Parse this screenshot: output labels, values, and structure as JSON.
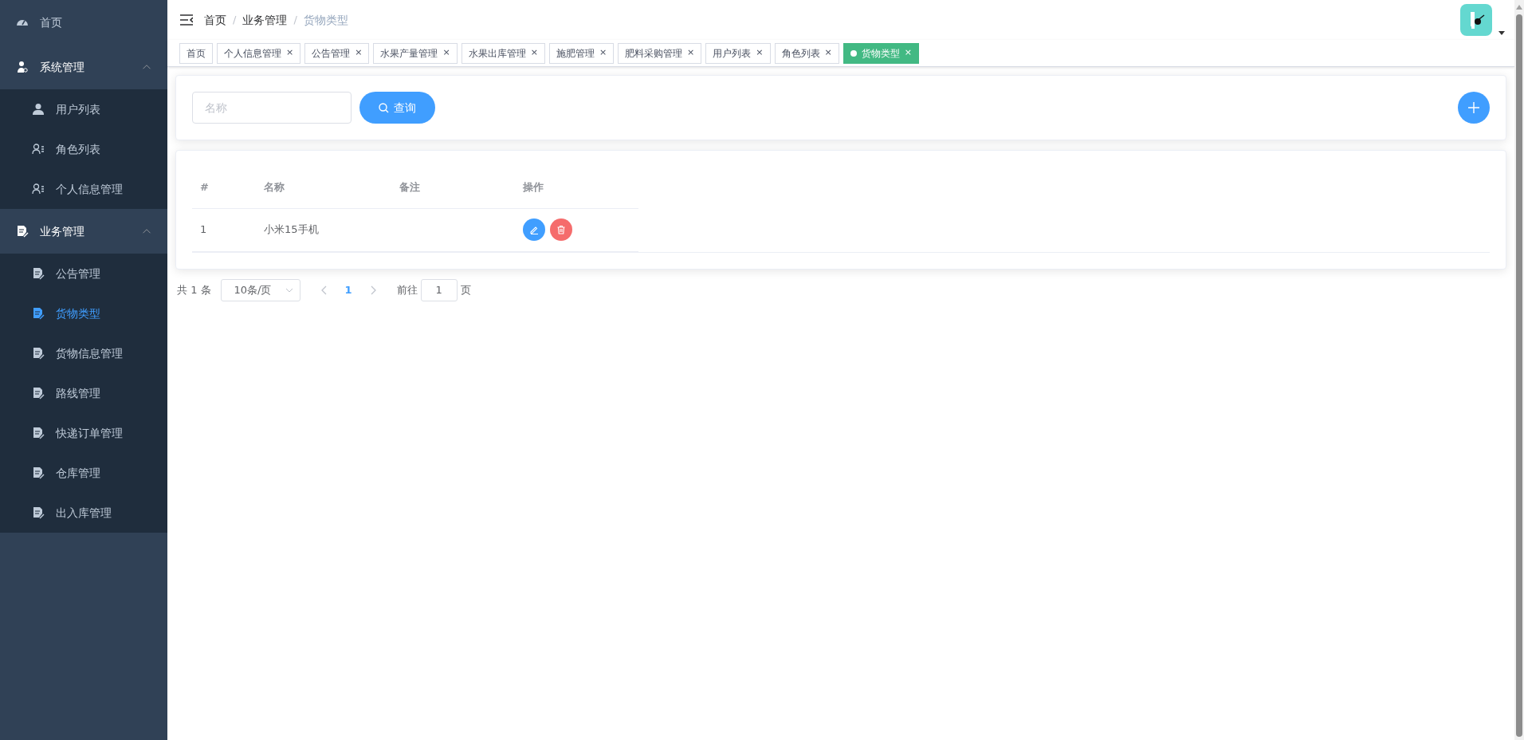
{
  "sidebar": {
    "items": [
      {
        "label": "首页",
        "selected": false
      },
      {
        "label": "系统管理",
        "selected": false,
        "expanded": true,
        "children": [
          {
            "label": "用户列表",
            "selected": false
          },
          {
            "label": "角色列表",
            "selected": false
          },
          {
            "label": "个人信息管理",
            "selected": false
          }
        ]
      },
      {
        "label": "业务管理",
        "selected": false,
        "expanded": true,
        "children": [
          {
            "label": "公告管理",
            "selected": false
          },
          {
            "label": "货物类型",
            "selected": true
          },
          {
            "label": "货物信息管理",
            "selected": false
          },
          {
            "label": "路线管理",
            "selected": false
          },
          {
            "label": "快递订单管理",
            "selected": false
          },
          {
            "label": "仓库管理",
            "selected": false
          },
          {
            "label": "出入库管理",
            "selected": false
          }
        ]
      }
    ]
  },
  "breadcrumb": [
    {
      "label": "首页",
      "separator": "/"
    },
    {
      "label": "业务管理",
      "separator": "/"
    },
    {
      "label": "货物类型"
    }
  ],
  "tags": [
    {
      "label": "首页",
      "selected": false
    },
    {
      "label": "个人信息管理",
      "selected": false,
      "close": "×"
    },
    {
      "label": "公告管理",
      "selected": false,
      "close": "×"
    },
    {
      "label": "水果产量管理",
      "selected": false,
      "close": "×"
    },
    {
      "label": "水果出库管理",
      "selected": false,
      "close": "×"
    },
    {
      "label": "施肥管理",
      "selected": false,
      "close": "×"
    },
    {
      "label": "肥料采购管理",
      "selected": false,
      "close": "×"
    },
    {
      "label": "用户列表",
      "selected": false,
      "close": "×"
    },
    {
      "label": "角色列表",
      "selected": false,
      "close": "×"
    },
    {
      "label": "货物类型",
      "selected": true,
      "close": "×"
    }
  ],
  "search": {
    "placeholder": "名称",
    "button": "查询"
  },
  "table": {
    "columns": [
      "#",
      "名称",
      "备注",
      "操作"
    ],
    "rows": [
      {
        "index": "1",
        "name": "小米15手机"
      }
    ]
  },
  "pagination": {
    "total": "共 1 条",
    "page_size": "10条/页",
    "pages": [
      {
        "label": "1",
        "selected": true
      }
    ],
    "goto_label": "前往",
    "goto_value": "1",
    "goto_suffix": "页"
  }
}
